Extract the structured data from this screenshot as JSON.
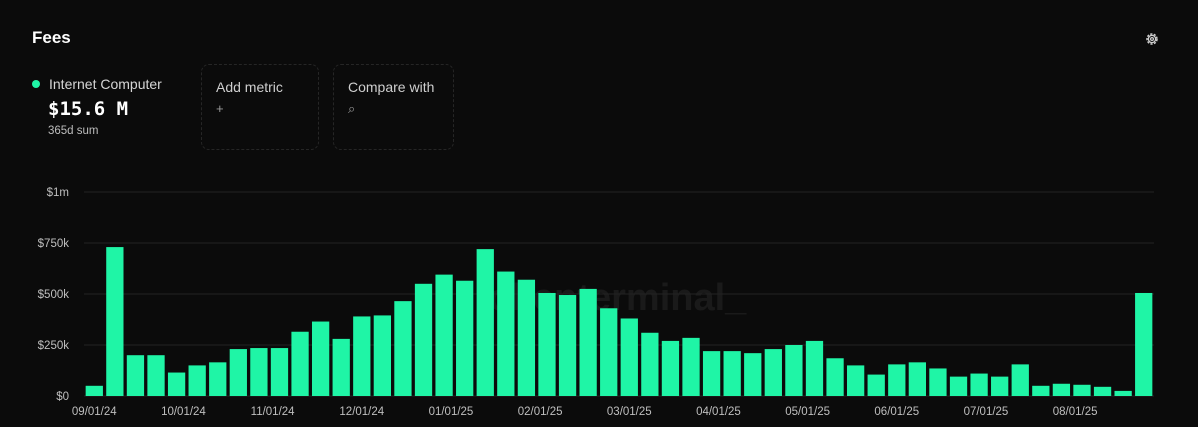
{
  "header": {
    "title": "Fees"
  },
  "colors": {
    "accent": "#1ff5a6",
    "grid": "#232323",
    "background": "#0b0b0b"
  },
  "metric": {
    "name": "Internet Computer",
    "value": "$15.6 M",
    "sub": "365d sum"
  },
  "add_metric": {
    "label": "Add metric",
    "icon": "+"
  },
  "compare": {
    "label": "Compare with",
    "icon": "⌕"
  },
  "watermark": "tokenterminal_",
  "chart_data": {
    "type": "bar",
    "title": "Fees",
    "series": [
      {
        "name": "Internet Computer"
      }
    ],
    "ylim": [
      0,
      1000000
    ],
    "y_ticks": [
      0,
      250000,
      500000,
      750000,
      1000000
    ],
    "y_tick_labels": [
      "$0",
      "$250k",
      "$500k",
      "$750k",
      "$1m"
    ],
    "x_tick_labels": [
      "09/01/24",
      "10/01/24",
      "11/01/24",
      "12/01/24",
      "01/01/25",
      "02/01/25",
      "03/01/25",
      "04/01/25",
      "05/01/25",
      "06/01/25",
      "07/01/25",
      "08/01/25"
    ],
    "values": [
      50000,
      730000,
      200000,
      200000,
      115000,
      150000,
      165000,
      230000,
      235000,
      235000,
      315000,
      365000,
      280000,
      390000,
      395000,
      465000,
      550000,
      595000,
      565000,
      720000,
      610000,
      570000,
      505000,
      495000,
      525000,
      430000,
      380000,
      310000,
      270000,
      285000,
      220000,
      220000,
      210000,
      230000,
      250000,
      270000,
      185000,
      150000,
      105000,
      155000,
      165000,
      135000,
      95000,
      110000,
      95000,
      155000,
      50000,
      60000,
      55000,
      45000,
      25000,
      505000
    ]
  }
}
